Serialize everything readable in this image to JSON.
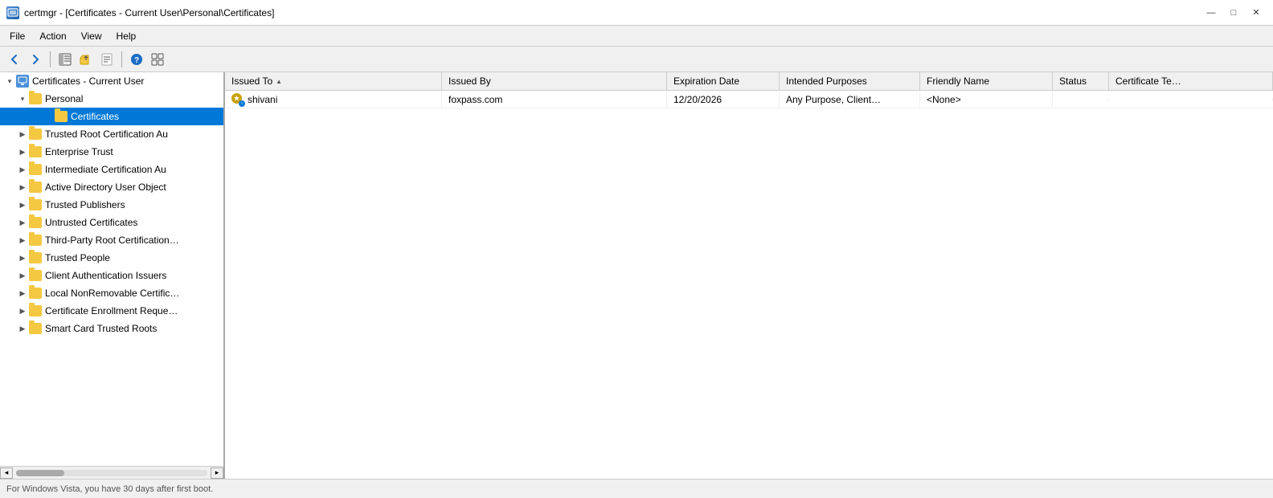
{
  "titlebar": {
    "title": "certmgr - [Certificates - Current User\\Personal\\Certificates]",
    "icon_label": "C",
    "minimize": "—",
    "maximize": "□",
    "close": "✕"
  },
  "menubar": {
    "items": [
      "File",
      "Action",
      "View",
      "Help"
    ]
  },
  "toolbar": {
    "buttons": [
      {
        "name": "back-button",
        "icon": "◀",
        "label": "Back"
      },
      {
        "name": "forward-button",
        "icon": "▶",
        "label": "Forward"
      },
      {
        "name": "up-button",
        "icon": "⬆",
        "label": "Up"
      },
      {
        "name": "show-hide-button",
        "icon": "⊞",
        "label": "Show/Hide"
      },
      {
        "name": "export-button",
        "icon": "📋",
        "label": "Export"
      },
      {
        "name": "properties-button",
        "icon": "📄",
        "label": "Properties"
      },
      {
        "name": "help-button",
        "icon": "?",
        "label": "Help"
      },
      {
        "name": "view-button",
        "icon": "⊟",
        "label": "View"
      }
    ]
  },
  "tree": {
    "root": "Certificates - Current User",
    "items": [
      {
        "id": "personal",
        "label": "Personal",
        "level": 1,
        "expanded": true,
        "has_children": true
      },
      {
        "id": "certificates",
        "label": "Certificates",
        "level": 2,
        "expanded": false,
        "has_children": false,
        "selected": true
      },
      {
        "id": "trusted-root",
        "label": "Trusted Root Certification Au",
        "level": 1,
        "expanded": false,
        "has_children": true
      },
      {
        "id": "enterprise-trust",
        "label": "Enterprise Trust",
        "level": 1,
        "expanded": false,
        "has_children": true
      },
      {
        "id": "intermediate",
        "label": "Intermediate Certification Au",
        "level": 1,
        "expanded": false,
        "has_children": true
      },
      {
        "id": "active-directory",
        "label": "Active Directory User Object",
        "level": 1,
        "expanded": false,
        "has_children": true
      },
      {
        "id": "trusted-publishers",
        "label": "Trusted Publishers",
        "level": 1,
        "expanded": false,
        "has_children": true
      },
      {
        "id": "untrusted",
        "label": "Untrusted Certificates",
        "level": 1,
        "expanded": false,
        "has_children": true
      },
      {
        "id": "third-party",
        "label": "Third-Party Root Certificatio…",
        "level": 1,
        "expanded": false,
        "has_children": true
      },
      {
        "id": "trusted-people",
        "label": "Trusted People",
        "level": 1,
        "expanded": false,
        "has_children": true
      },
      {
        "id": "client-auth",
        "label": "Client Authentication Issuers",
        "level": 1,
        "expanded": false,
        "has_children": true
      },
      {
        "id": "local-nonremovable",
        "label": "Local NonRemovable Certific…",
        "level": 1,
        "expanded": false,
        "has_children": true
      },
      {
        "id": "cert-enrollment",
        "label": "Certificate Enrollment Reque…",
        "level": 1,
        "expanded": false,
        "has_children": true
      },
      {
        "id": "smart-card",
        "label": "Smart Card Trusted Roots",
        "level": 1,
        "expanded": false,
        "has_children": true
      }
    ]
  },
  "table": {
    "columns": [
      {
        "id": "issued-to",
        "label": "Issued To",
        "sorted": true
      },
      {
        "id": "issued-by",
        "label": "Issued By"
      },
      {
        "id": "expiration",
        "label": "Expiration Date"
      },
      {
        "id": "purposes",
        "label": "Intended Purposes"
      },
      {
        "id": "friendly",
        "label": "Friendly Name"
      },
      {
        "id": "status",
        "label": "Status"
      },
      {
        "id": "cert-te",
        "label": "Certificate Te…"
      }
    ],
    "rows": [
      {
        "issued_to": "shivani",
        "issued_by": "foxpass.com",
        "expiration": "12/20/2026",
        "purposes": "Any Purpose, Client…",
        "friendly": "<None>",
        "status": "",
        "cert_te": ""
      }
    ]
  },
  "statusbar": {
    "text": "For Windows Vista, you have 30 days after first boot."
  }
}
